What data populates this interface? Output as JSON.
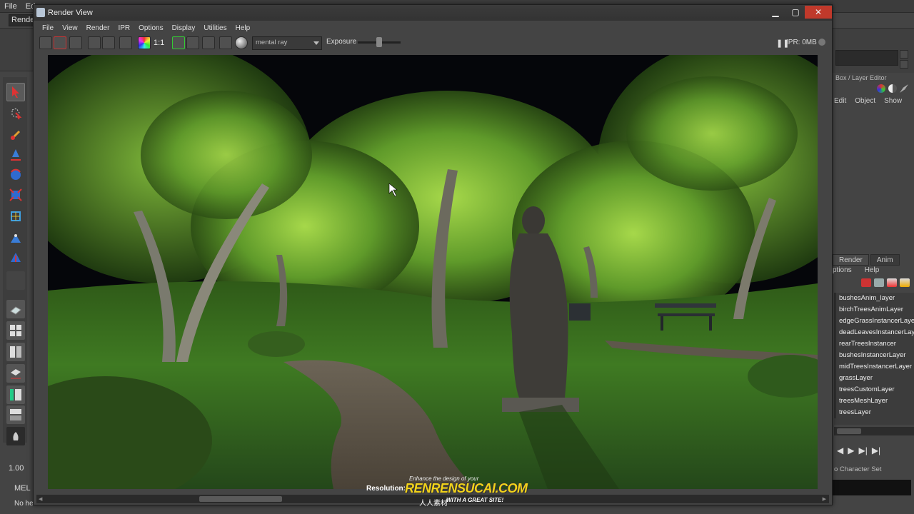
{
  "maya": {
    "menu": [
      "File",
      "Ed"
    ],
    "mode_dropdown": "Render",
    "time_field": "1.00",
    "mel_label": "MEL",
    "help_line": "No he"
  },
  "render_view": {
    "title": "Render View",
    "menu": [
      "File",
      "View",
      "Render",
      "IPR",
      "Options",
      "Display",
      "Utilities",
      "Help"
    ],
    "ratio_label": "1:1",
    "renderer": "mental ray",
    "exposure_label": "Exposure",
    "ipr_status": "IPR: 0MB",
    "resolution_label": "Resolution:"
  },
  "right_panel": {
    "channel_box_title": "Box / Layer Editor",
    "channel_box_menu": [
      "Edit",
      "Object",
      "Show"
    ],
    "layer_tabs": [
      "Render",
      "Anim"
    ],
    "layer_menu": [
      "ptions",
      "Help"
    ],
    "layers": [
      "bushesAnim_layer",
      "birchTreesAnimLayer",
      "edgeGrassInstancerLayer",
      "deadLeavesInstancerLayer",
      "rearTreesInstancer",
      "bushesInstancerLayer",
      "midTreesInstancerLayer",
      "grassLayer",
      "treesCustomLayer",
      "treesMeshLayer",
      "treesLayer"
    ],
    "character_set": "o Character Set"
  },
  "watermark": {
    "tagline": "Enhance the design of your",
    "brand": "RENRENSUCAI.COM",
    "cn": "人人素材",
    "slogan": "WITH A GREAT SITE!"
  },
  "colors": {
    "accent_red": "#c0392b",
    "grass": "#3f7a22",
    "foliage": "#8fc83a"
  }
}
